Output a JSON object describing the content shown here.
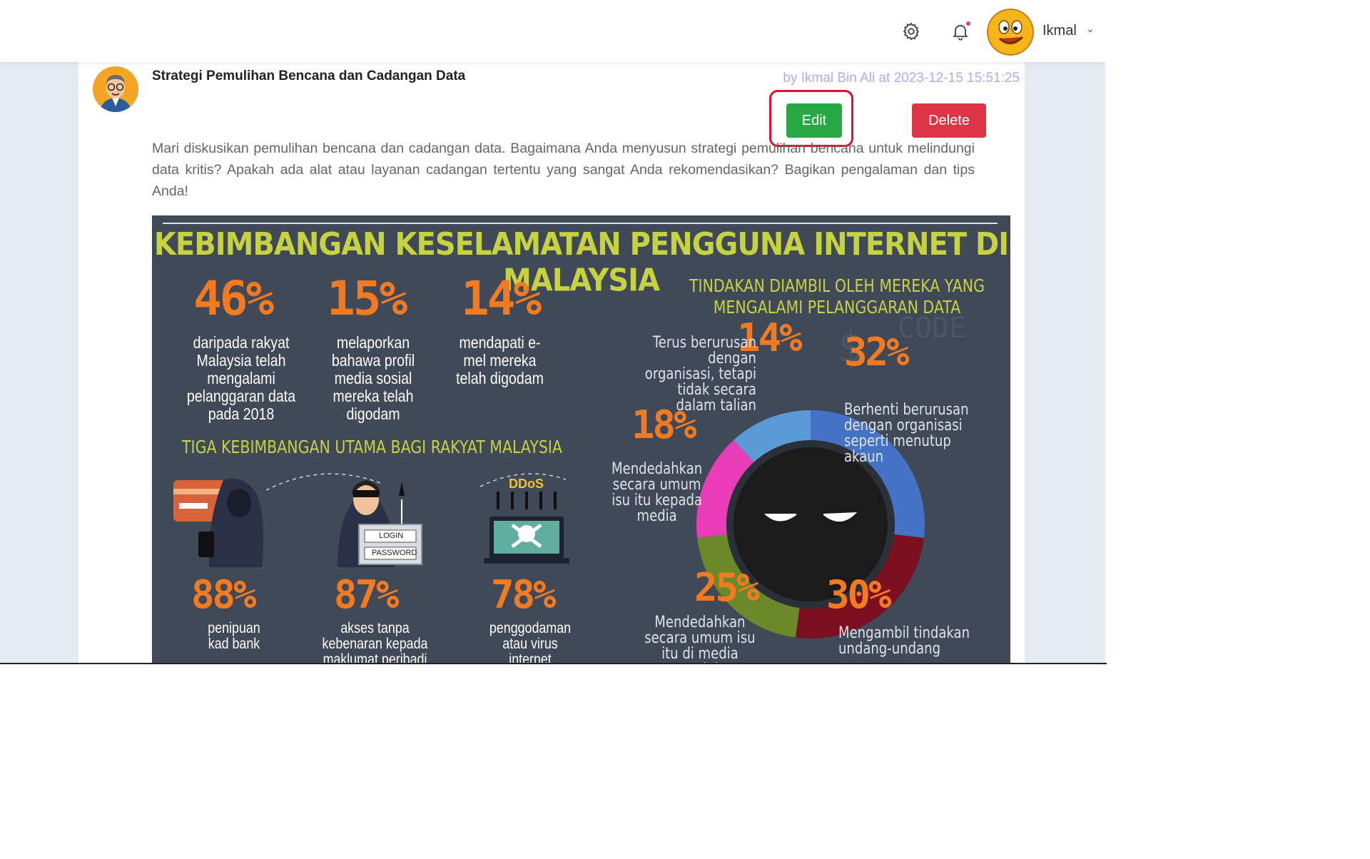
{
  "navbar": {
    "settings_icon": "gear-icon",
    "notification_icon": "bell-icon",
    "user_name": "Ikmal",
    "user_menu_icon": "chevron-down-icon"
  },
  "post": {
    "title": "Strategi Pemulihan Bencana dan Cadangan Data",
    "meta": "by Ikmal Bin Ali at 2023-12-15 15:51:25",
    "edit_label": "Edit",
    "delete_label": "Delete",
    "body": "Mari diskusikan pemulihan bencana dan cadangan data. Bagaimana Anda menyusun strategi pemulihan bencana untuk melindungi data kritis? Apakah ada alat atau layanan cadangan tertentu yang sangat Anda rekomendasikan? Bagikan pengalaman dan tips Anda!"
  },
  "infographic": {
    "title": "KEBIMBANGAN KESELAMATAN PENGGUNA INTERNET DI MALAYSIA",
    "stats_top": [
      {
        "pct": "46%",
        "text": "daripada rakyat Malaysia telah mengalami pelanggaran data pada 2018"
      },
      {
        "pct": "15%",
        "text": "melaporkan bahawa profil media sosial mereka telah digodam"
      },
      {
        "pct": "14%",
        "text": "mendapati e-mel mereka telah digodam"
      }
    ],
    "concerns_head": "TIGA KEBIMBANGAN UTAMA BAGI RAKYAT MALAYSIA",
    "concerns": [
      {
        "pct": "88%",
        "text": "penipuan kad bank"
      },
      {
        "pct": "87%",
        "text": "akses tanpa kebenaran kepada maklumat peribadi"
      },
      {
        "pct": "78%",
        "text": "penggodaman atau virus internet"
      }
    ],
    "login_label": "LOGIN",
    "password_label": "PASSWORD",
    "ddos_label": "DDoS",
    "actions_head": "TINDAKAN DIAMBIL OLEH MEREKA YANG MENGALAMI PELANGGARAN DATA",
    "actions": [
      {
        "pct": "14%",
        "text": "Terus berurusan dengan organisasi, tetapi tidak secara dalam talian",
        "color": "#5b9bd5"
      },
      {
        "pct": "32%",
        "text": "Berhenti berurusan dengan organisasi seperti menutup akaun",
        "color": "#4472c4"
      },
      {
        "pct": "30%",
        "text": "Mengambil tindakan undang-undang",
        "color": "#7a1020"
      },
      {
        "pct": "25%",
        "text": "Mendedahkan secara umum isu itu di media sosial",
        "color": "#6a8a2a"
      },
      {
        "pct": "18%",
        "text": "Mendedahkan secara umum isu itu kepada media",
        "color": "#e83cb8"
      }
    ]
  }
}
